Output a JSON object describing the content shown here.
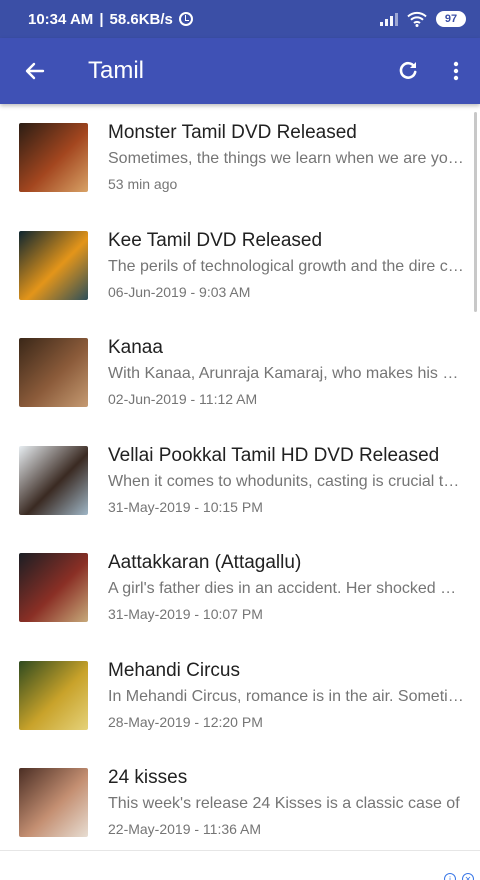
{
  "status_bar": {
    "time": "10:34 AM",
    "network_speed": "58.6KB/s",
    "battery": "97"
  },
  "app_bar": {
    "title": "Tamil",
    "color": "#3f51b5"
  },
  "items": [
    {
      "title": "Monster Tamil DVD Released",
      "description": "Sometimes, the things we learn when we are young stay with us",
      "time": "53 min ago"
    },
    {
      "title": "Kee Tamil DVD Released",
      "description": "The perils of technological growth and the dire consequences",
      "time": "06-Jun-2019 - 9:03 AM"
    },
    {
      "title": "Kanaa",
      "description": "With Kanaa, Arunraja Kamaraj, who makes his directorial debut",
      "time": "02-Jun-2019 - 11:12 AM"
    },
    {
      "title": "Vellai Pookkal Tamil HD DVD Released",
      "description": "When it comes to whodunits, casting is crucial to the story",
      "time": "31-May-2019 - 10:15 PM"
    },
    {
      "title": "Aattakkaran (Attagallu)",
      "description": "A girl's father dies in an accident. Her shocked brother",
      "time": "31-May-2019 - 10:07 PM"
    },
    {
      "title": "Mehandi Circus",
      "description": "In Mehandi Circus, romance is in the air. Sometimes",
      "time": "28-May-2019 - 12:20 PM"
    },
    {
      "title": "24 kisses",
      "description": "This week's release 24 Kisses is a classic case of",
      "time": "22-May-2019 - 11:36 AM"
    }
  ],
  "thumb_colors": [
    [
      "#2b1d14",
      "#a3461f",
      "#d8a266"
    ],
    [
      "#0e2630",
      "#e3951a",
      "#2d4f5a"
    ],
    [
      "#3a2718",
      "#8b5b3a",
      "#c59a72"
    ],
    [
      "#e8eef2",
      "#3a2a22",
      "#9fb6c6"
    ],
    [
      "#1b1e24",
      "#8a2f25",
      "#c7a97a"
    ],
    [
      "#2f4a1f",
      "#c8a22a",
      "#e5d27a"
    ],
    [
      "#4b2e24",
      "#c48f72",
      "#e7ddd2"
    ]
  ]
}
